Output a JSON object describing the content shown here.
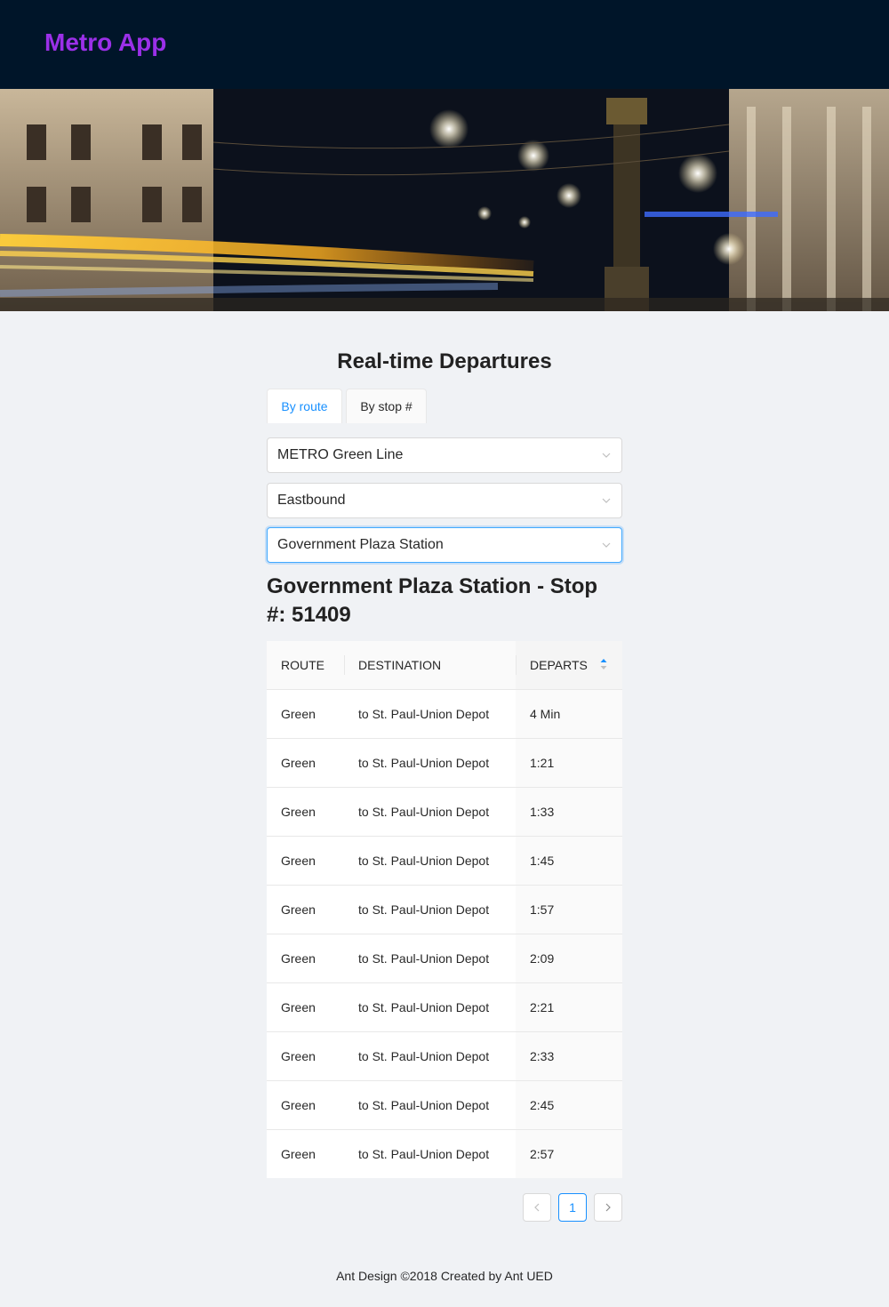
{
  "header": {
    "brand": "Metro App"
  },
  "hero": {
    "image": "night-city-street-photo"
  },
  "page": {
    "title": "Real-time Departures"
  },
  "tabs": [
    {
      "label": "By route",
      "active": true
    },
    {
      "label": "By stop #",
      "active": false
    }
  ],
  "selects": {
    "route": "METRO Green Line",
    "direction": "Eastbound",
    "stop": "Government Plaza Station"
  },
  "stop": {
    "heading": "Government Plaza Station - Stop #: 51409"
  },
  "table": {
    "columns": [
      "ROUTE",
      "DESTINATION",
      "DEPARTS"
    ],
    "sorted_column": "DEPARTS",
    "rows": [
      [
        "Green",
        "to St. Paul-Union Depot",
        "4 Min"
      ],
      [
        "Green",
        "to St. Paul-Union Depot",
        "1:21"
      ],
      [
        "Green",
        "to St. Paul-Union Depot",
        "1:33"
      ],
      [
        "Green",
        "to St. Paul-Union Depot",
        "1:45"
      ],
      [
        "Green",
        "to St. Paul-Union Depot",
        "1:57"
      ],
      [
        "Green",
        "to St. Paul-Union Depot",
        "2:09"
      ],
      [
        "Green",
        "to St. Paul-Union Depot",
        "2:21"
      ],
      [
        "Green",
        "to St. Paul-Union Depot",
        "2:33"
      ],
      [
        "Green",
        "to St. Paul-Union Depot",
        "2:45"
      ],
      [
        "Green",
        "to St. Paul-Union Depot",
        "2:57"
      ]
    ]
  },
  "pagination": {
    "current": "1"
  },
  "footer": {
    "text": "Ant Design ©2018 Created by Ant UED"
  },
  "colors": {
    "brand": "#9b30e8",
    "header_bg": "#001529",
    "accent": "#1890ff",
    "page_bg": "#f0f2f5"
  }
}
